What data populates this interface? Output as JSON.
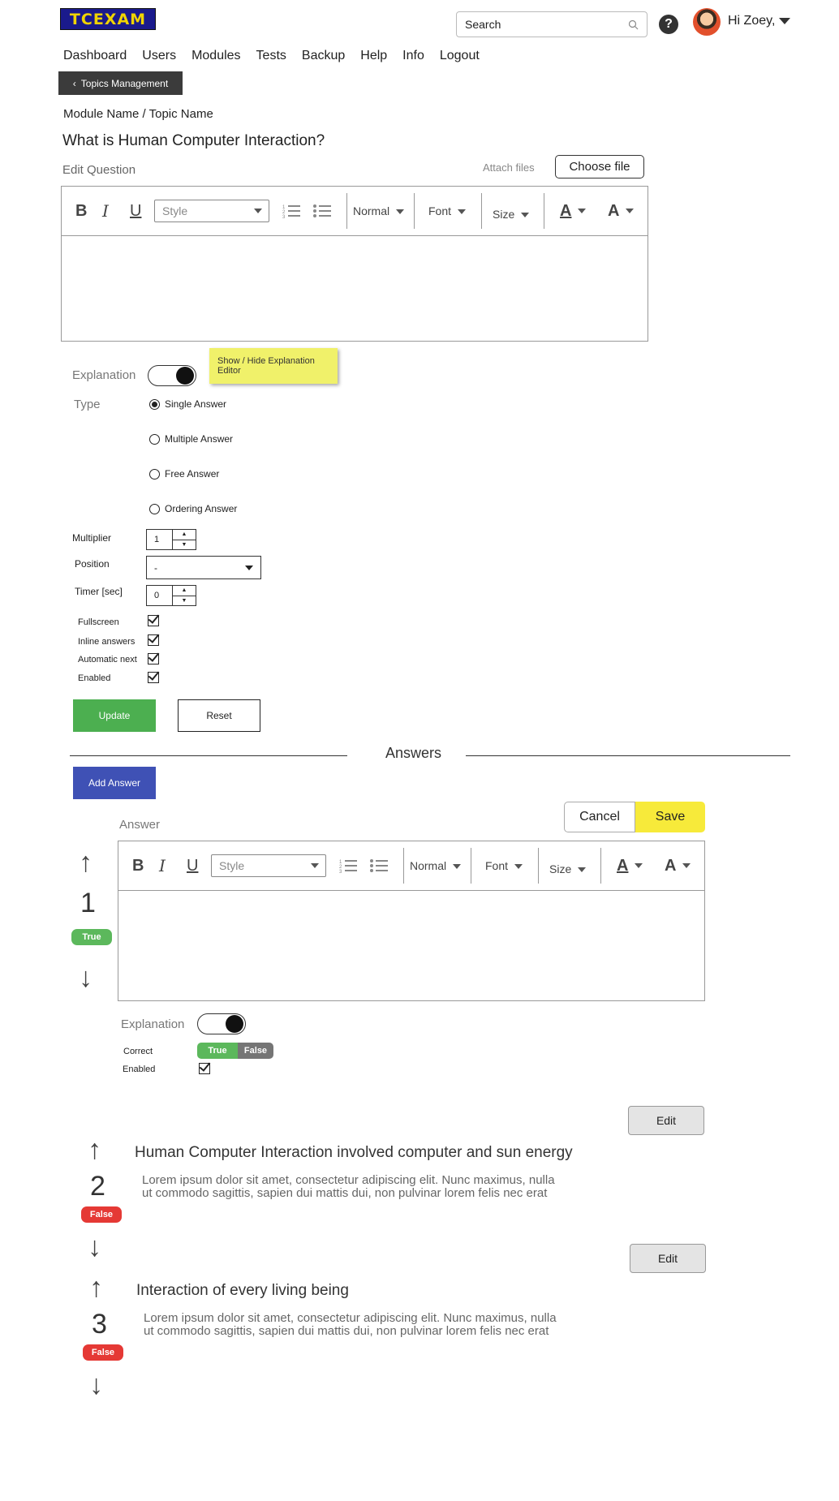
{
  "header": {
    "logo_text": "TCEXAM",
    "search_placeholder": "Search",
    "greeting": "Hi Zoey,"
  },
  "nav": [
    "Dashboard",
    "Users",
    "Modules",
    "Tests",
    "Backup",
    "Help",
    "Info",
    "Logout"
  ],
  "back_button": "Topics Management",
  "breadcrumb": "Module Name / Topic Name",
  "question": {
    "title": "What is Human Computer Interaction?",
    "edit_label": "Edit Question",
    "attach_label": "Attach files",
    "choose_file": "Choose file"
  },
  "editor_toolbar": {
    "bold": "B",
    "italic": "I",
    "underline": "U",
    "style": "Style",
    "format": "Normal",
    "font": "Font",
    "size": "Size",
    "text_color": "A",
    "bg_color": "A"
  },
  "explanation_label": "Explanation",
  "tooltip": "Show / Hide Explanation Editor",
  "type": {
    "label": "Type",
    "options": [
      "Single Answer",
      "Multiple Answer",
      "Free Answer",
      "Ordering Answer"
    ],
    "selected": "Single Answer"
  },
  "fields": {
    "multiplier_label": "Multiplier",
    "multiplier_value": "1",
    "position_label": "Position",
    "position_value": "-",
    "timer_label": "Timer [sec]",
    "timer_value": "0"
  },
  "checkboxes": [
    {
      "label": "Fullscreen",
      "checked": true
    },
    {
      "label": "Inline answers",
      "checked": true
    },
    {
      "label": "Automatic next",
      "checked": true
    },
    {
      "label": "Enabled",
      "checked": true
    }
  ],
  "buttons": {
    "update": "Update",
    "reset": "Reset",
    "add_answer": "Add Answer",
    "cancel": "Cancel",
    "save": "Save",
    "edit": "Edit"
  },
  "answers_title": "Answers",
  "answer_editor": {
    "label": "Answer",
    "number": "1",
    "status": "True",
    "explanation_label": "Explanation",
    "correct_label": "Correct",
    "correct_true": "True",
    "correct_false": "False",
    "enabled_label": "Enabled"
  },
  "answers": [
    {
      "number": "2",
      "status": "False",
      "title": "Human Computer Interaction involved computer and sun energy",
      "description": "Lorem ipsum dolor sit amet, consectetur adipiscing elit. Nunc maximus, nulla ut commodo sagittis, sapien dui mattis dui, non pulvinar lorem felis nec erat"
    },
    {
      "number": "3",
      "status": "False",
      "title": "Interaction of every living being",
      "description": "Lorem ipsum dolor sit amet, consectetur adipiscing elit. Nunc maximus, nulla ut commodo sagittis, sapien dui mattis dui, non pulvinar lorem felis nec erat"
    }
  ],
  "colors": {
    "green": "#4caf50",
    "blue": "#3f51b5",
    "yellow": "#f7ea3a",
    "red": "#e53935"
  }
}
